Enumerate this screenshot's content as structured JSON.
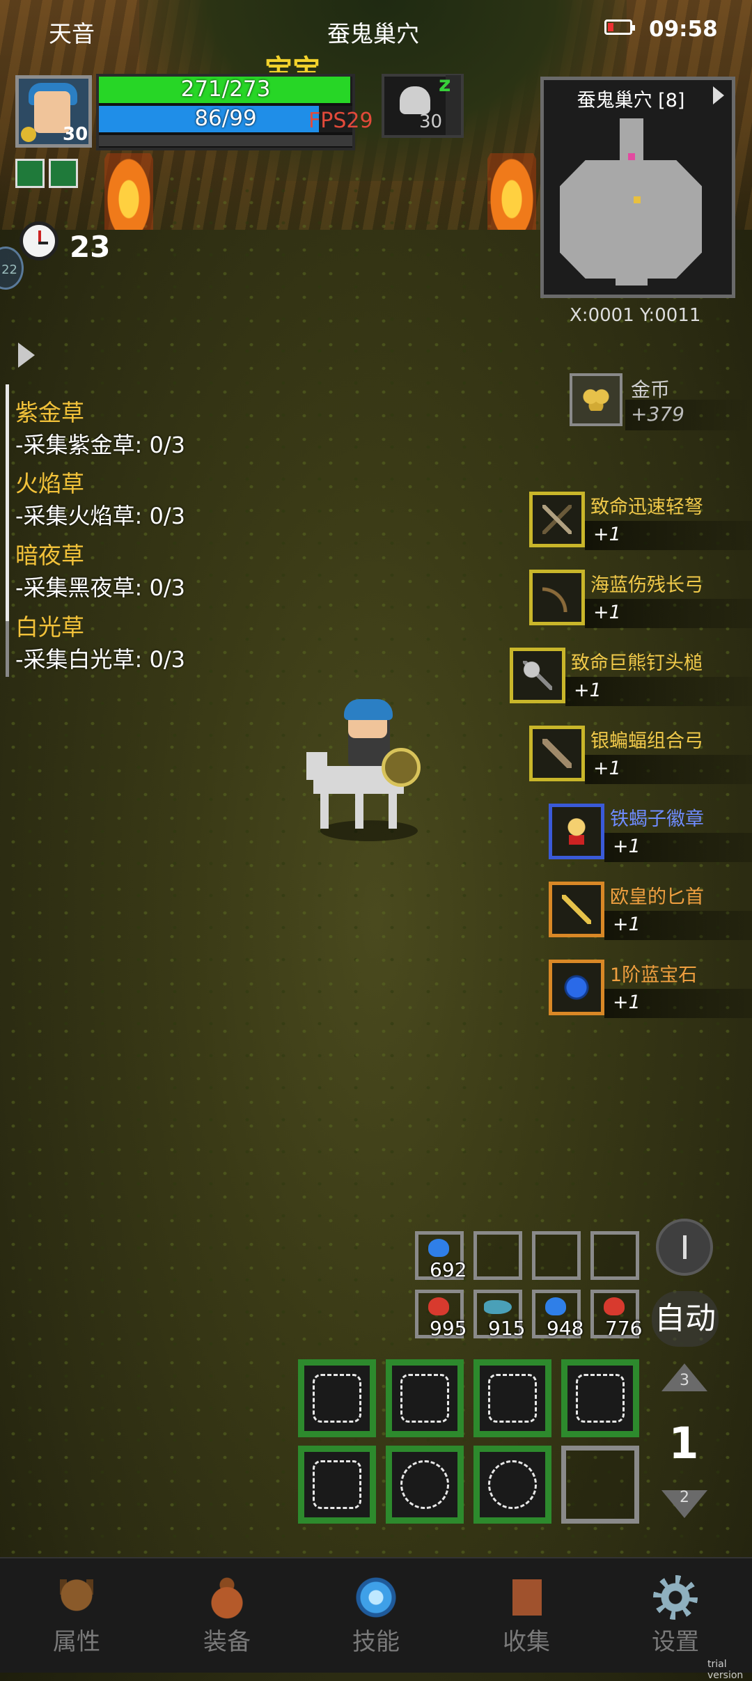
{
  "status_bar": {
    "left": "天音",
    "center": "蚕鬼巢穴",
    "time": "09:58"
  },
  "player": {
    "name": "宝宝",
    "level": "30",
    "hp_text": "271/273",
    "hp_fraction": 0.993,
    "mp_text": "86/99",
    "mp_fraction": 0.869,
    "fps": "FPS29"
  },
  "pet": {
    "level": "30",
    "sleep": "z"
  },
  "timer": {
    "value": "23",
    "side_badge": "22"
  },
  "quests": [
    {
      "name": "紫金草",
      "task": "-采集紫金草: 0/3"
    },
    {
      "name": "火焰草",
      "task": "-采集火焰草: 0/3"
    },
    {
      "name": "暗夜草",
      "task": "-采集黑夜草: 0/3"
    },
    {
      "name": "白光草",
      "task": "-采集白光草: 0/3"
    }
  ],
  "minimap": {
    "title": "蚕鬼巢穴 [8]",
    "coords": "X:0001  Y:0011"
  },
  "gold": {
    "label": "金币",
    "amount": "+379"
  },
  "loot": [
    {
      "name": "致命迅速轻弩",
      "count": "+1",
      "color": "#f0c94a",
      "rarity": "gold",
      "icon": "crossbow-icon"
    },
    {
      "name": "海蓝伤残长弓",
      "count": "+1",
      "color": "#f0c94a",
      "rarity": "gold",
      "icon": "longbow-icon"
    },
    {
      "name": "致命巨熊钉头槌",
      "count": "+1",
      "color": "#f0c94a",
      "rarity": "gold",
      "icon": "mace-icon"
    },
    {
      "name": "银蝙蝠组合弓",
      "count": "+1",
      "color": "#f0c94a",
      "rarity": "gold",
      "icon": "composite-bow-icon"
    },
    {
      "name": "铁蝎子徽章",
      "count": "+1",
      "color": "#6f8cff",
      "rarity": "blue",
      "icon": "badge-icon"
    },
    {
      "name": "欧皇的匕首",
      "count": "+1",
      "color": "#f0a040",
      "rarity": "orange",
      "icon": "dagger-icon"
    },
    {
      "name": "1阶蓝宝石",
      "count": "+1",
      "color": "#f0a040",
      "rarity": "orange",
      "icon": "sapphire-icon"
    }
  ],
  "consumables": {
    "row1": [
      {
        "count": "692",
        "color": "#2f7fe8"
      }
    ],
    "row2": [
      {
        "count": "995",
        "color": "#d83a2e"
      },
      {
        "count": "915",
        "color": "#4aa0b8"
      },
      {
        "count": "948",
        "color": "#2f7fe8"
      },
      {
        "count": "776",
        "color": "#d83a2e"
      }
    ]
  },
  "controls": {
    "auto": "自动",
    "page_up": "3",
    "page_current": "1",
    "page_down": "2"
  },
  "nav": [
    {
      "label": "属性",
      "icon": "helmet-icon"
    },
    {
      "label": "装备",
      "icon": "bag-icon"
    },
    {
      "label": "技能",
      "icon": "crystal-icon"
    },
    {
      "label": "收集",
      "icon": "book-icon"
    },
    {
      "label": "设置",
      "icon": "gear-icon"
    }
  ],
  "watermark": "trial version"
}
